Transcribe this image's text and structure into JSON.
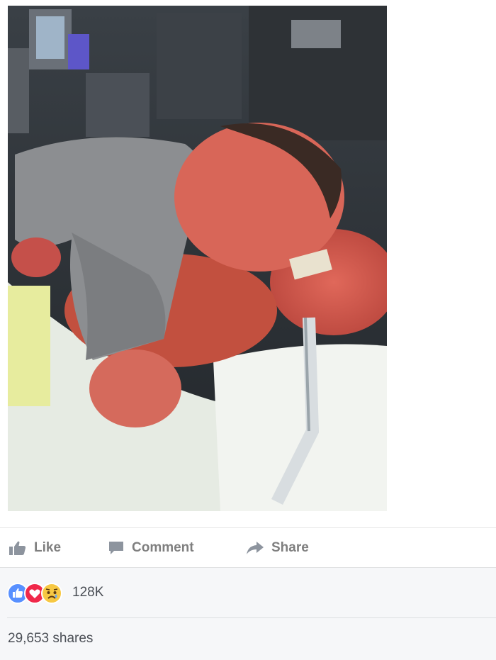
{
  "post": {
    "actions": {
      "like_label": "Like",
      "comment_label": "Comment",
      "share_label": "Share"
    },
    "reactions": {
      "icons": [
        "like-icon",
        "love-icon",
        "sad-icon"
      ],
      "count": "128K"
    },
    "shares_text": "29,653 shares"
  },
  "colors": {
    "action_text": "#7f7f7f",
    "like_blue": "#5890ff",
    "love_red": "#f0284a",
    "sad_yellow": "#f7c843",
    "footer_bg": "#f6f7f9"
  }
}
